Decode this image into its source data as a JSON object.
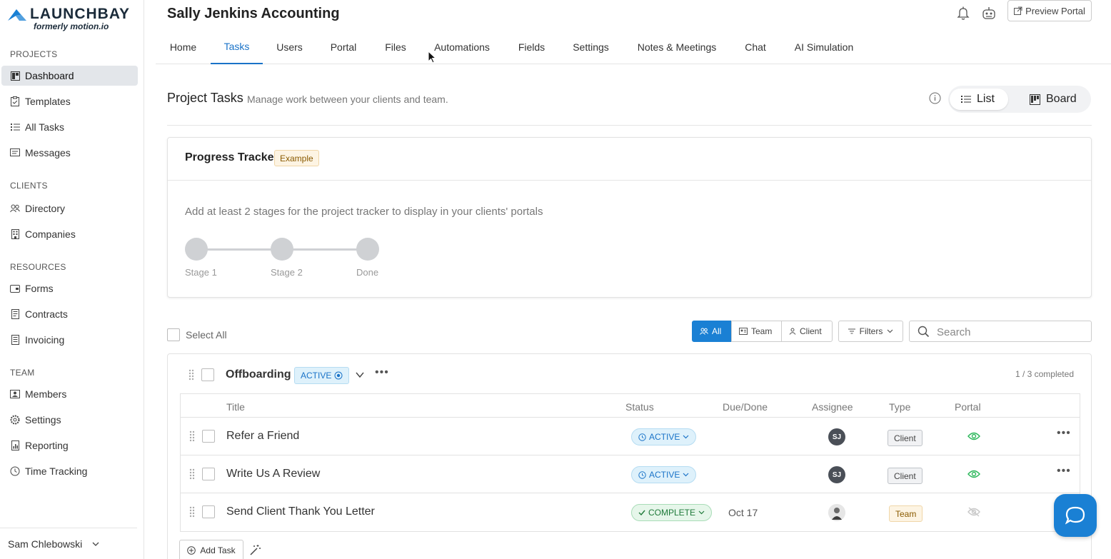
{
  "brand": {
    "name": "LAUNCHBAY",
    "subtitle": "formerly motion.io",
    "accent": "#1a80d4"
  },
  "sidebar": {
    "sections": [
      {
        "title": "PROJECTS",
        "items": [
          {
            "label": "Dashboard",
            "icon": "dashboard-icon",
            "active": true
          },
          {
            "label": "Templates",
            "icon": "clipboard-icon"
          },
          {
            "label": "All Tasks",
            "icon": "list-icon"
          },
          {
            "label": "Messages",
            "icon": "message-icon"
          }
        ]
      },
      {
        "title": "CLIENTS",
        "items": [
          {
            "label": "Directory",
            "icon": "people-icon"
          },
          {
            "label": "Companies",
            "icon": "building-icon"
          }
        ]
      },
      {
        "title": "RESOURCES",
        "items": [
          {
            "label": "Forms",
            "icon": "form-icon"
          },
          {
            "label": "Contracts",
            "icon": "contract-icon"
          },
          {
            "label": "Invoicing",
            "icon": "invoice-icon"
          }
        ]
      },
      {
        "title": "TEAM",
        "items": [
          {
            "label": "Members",
            "icon": "member-icon"
          },
          {
            "label": "Settings",
            "icon": "gear-icon"
          },
          {
            "label": "Reporting",
            "icon": "report-icon"
          },
          {
            "label": "Time Tracking",
            "icon": "clock-icon"
          }
        ]
      }
    ],
    "user": "Sam Chlebowski"
  },
  "header": {
    "title": "Sally Jenkins Accounting",
    "preview_label": "Preview Portal"
  },
  "tabs": [
    {
      "label": "Home"
    },
    {
      "label": "Tasks",
      "active": true
    },
    {
      "label": "Users"
    },
    {
      "label": "Portal"
    },
    {
      "label": "Files"
    },
    {
      "label": "Automations"
    },
    {
      "label": "Fields"
    },
    {
      "label": "Settings"
    },
    {
      "label": "Notes & Meetings"
    },
    {
      "label": "Chat"
    },
    {
      "label": "AI Simulation"
    }
  ],
  "project_tasks": {
    "title": "Project Tasks",
    "subtitle": "Manage work between your clients and team.",
    "view_list": "List",
    "view_board": "Board"
  },
  "tracker": {
    "title": "Progress Tracker",
    "badge": "Example",
    "message": "Add at least 2 stages for the project tracker to display in your clients' portals",
    "stages": [
      "Stage 1",
      "Stage 2",
      "Done"
    ]
  },
  "toolbar": {
    "select_all": "Select All",
    "segments": [
      "All",
      "Team",
      "Client"
    ],
    "filters": "Filters",
    "search_placeholder": "Search"
  },
  "group": {
    "name": "Offboarding",
    "status": "ACTIVE",
    "completed": "1 / 3 completed",
    "columns": [
      "Title",
      "Status",
      "Due/Done",
      "Assignee",
      "Type",
      "Portal"
    ],
    "rows": [
      {
        "title": "Refer a Friend",
        "status": "ACTIVE",
        "due": "",
        "assignee": "SJ",
        "type": "Client",
        "portal_visible": true
      },
      {
        "title": "Write Us A Review",
        "status": "ACTIVE",
        "due": "",
        "assignee": "SJ",
        "type": "Client",
        "portal_visible": true
      },
      {
        "title": "Send Client Thank You Letter",
        "status": "COMPLETE",
        "due": "Oct 17",
        "assignee": "",
        "type": "Team",
        "portal_visible": false
      }
    ],
    "add_task": "Add Task"
  }
}
